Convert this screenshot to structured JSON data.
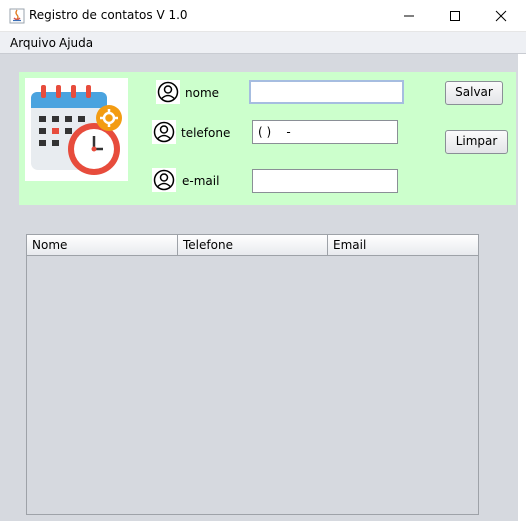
{
  "window": {
    "title": "Registro de contatos V 1.0",
    "controls": [
      "minimize",
      "maximize",
      "close"
    ]
  },
  "menu": {
    "items": [
      "Arquivo",
      "Ajuda"
    ]
  },
  "form": {
    "background_color": "#ccffcc",
    "logo_icon": "calendar-clock-icon",
    "fields": {
      "nome": {
        "label": "nome",
        "value": "",
        "icon": "user-icon"
      },
      "telefone": {
        "label": "telefone",
        "value": "( )    -",
        "icon": "user-icon"
      },
      "email": {
        "label": "e-mail",
        "value": "",
        "icon": "user-icon"
      }
    },
    "buttons": {
      "save": "Salvar",
      "clear": "Limpar"
    }
  },
  "table": {
    "columns": [
      "Nome",
      "Telefone",
      "Email"
    ],
    "rows": []
  }
}
